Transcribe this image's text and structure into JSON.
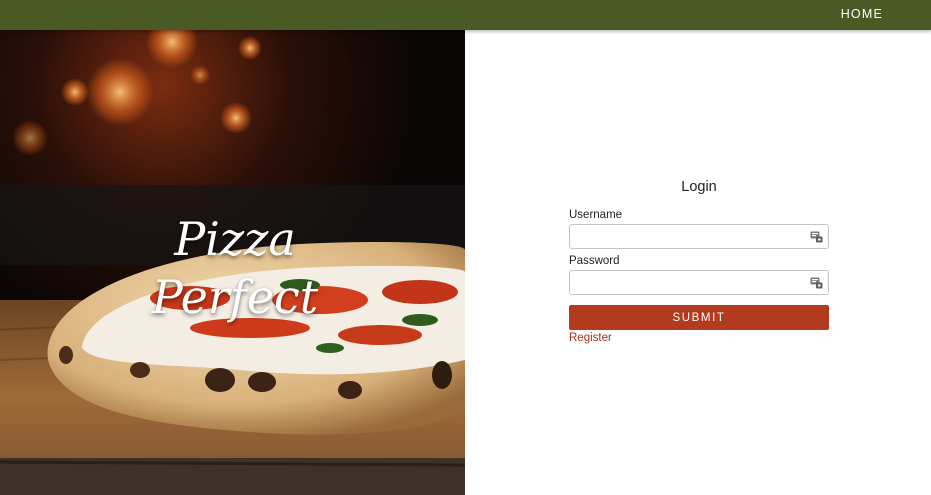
{
  "nav": {
    "home_label": "HOME"
  },
  "hero": {
    "title_line1": "Pizza",
    "title_line2": "Perfect"
  },
  "login": {
    "heading": "Login",
    "username_label": "Username",
    "username_value": "",
    "password_label": "Password",
    "password_value": "",
    "submit_label": "SUBMIT",
    "register_label": "Register",
    "field_icon": "password-manager-icon"
  },
  "colors": {
    "navbar": "#4a5a24",
    "submit_button": "#b23a1e",
    "register_link": "#a3321c"
  }
}
